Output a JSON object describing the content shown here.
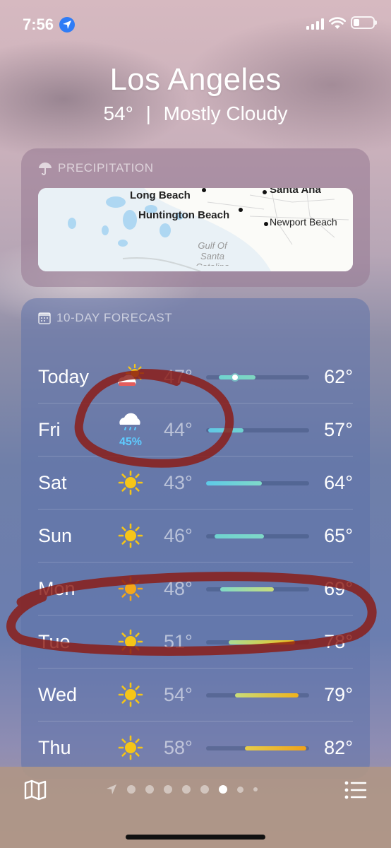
{
  "status_bar": {
    "time": "7:56"
  },
  "header": {
    "city": "Los Angeles",
    "temperature": "54°",
    "separator": "|",
    "condition": "Mostly Cloudy"
  },
  "precipitation": {
    "title": "PRECIPITATION",
    "map_labels": {
      "long_beach": "Long Beach",
      "santa_ana": "Santa Ana",
      "huntington_beach": "Huntington Beach",
      "newport_beach": "Newport Beach",
      "gulf_line1": "Gulf Of",
      "gulf_line2": "Santa",
      "gulf_line3": "Catalina"
    }
  },
  "forecast": {
    "title": "10-DAY FORECAST",
    "days": [
      {
        "day": "Today",
        "icon": "partly-cloudy-sun-icon",
        "low": "47°",
        "high": "62°",
        "precip": "",
        "range_start": 0.12,
        "range_end": 0.48,
        "current": 0.28,
        "color_from": "#6fd3d0",
        "color_to": "#7fd6c0"
      },
      {
        "day": "Fri",
        "icon": "cloud-rain-icon",
        "low": "44°",
        "high": "57°",
        "precip": "45%",
        "range_start": 0.02,
        "range_end": 0.36,
        "color_from": "#60c8e6",
        "color_to": "#6fd3d0"
      },
      {
        "day": "Sat",
        "icon": "sun-icon",
        "low": "43°",
        "high": "64°",
        "precip": "",
        "range_start": 0.0,
        "range_end": 0.54,
        "color_from": "#5ec9e8",
        "color_to": "#7fd9c8"
      },
      {
        "day": "Sun",
        "icon": "sun-icon",
        "low": "46°",
        "high": "65°",
        "precip": "",
        "range_start": 0.08,
        "range_end": 0.56,
        "color_from": "#6fd3d0",
        "color_to": "#7fd9c8"
      },
      {
        "day": "Mon",
        "icon": "sun-icon",
        "low": "48°",
        "high": "69°",
        "precip": "",
        "range_start": 0.14,
        "range_end": 0.66,
        "color_from": "#7fd9c8",
        "color_to": "#c9dd7a"
      },
      {
        "day": "Tue",
        "icon": "sun-icon",
        "low": "51°",
        "high": "78°",
        "precip": "",
        "range_start": 0.22,
        "range_end": 0.86,
        "color_from": "#a9dc95",
        "color_to": "#f1c21b"
      },
      {
        "day": "Wed",
        "icon": "sun-icon",
        "low": "54°",
        "high": "79°",
        "precip": "",
        "range_start": 0.28,
        "range_end": 0.9,
        "color_from": "#c9dd7a",
        "color_to": "#f0b21a"
      },
      {
        "day": "Thu",
        "icon": "sun-icon",
        "low": "58°",
        "high": "82°",
        "precip": "",
        "range_start": 0.38,
        "range_end": 0.97,
        "color_from": "#e6cd4a",
        "color_to": "#f0a21a"
      }
    ]
  },
  "colors": {
    "sun": "#f5c518",
    "rain_text": "#5ecbff",
    "annotation": "#8b1a12"
  },
  "bottom_bar": {
    "page_count": 9,
    "active_page": 7
  }
}
